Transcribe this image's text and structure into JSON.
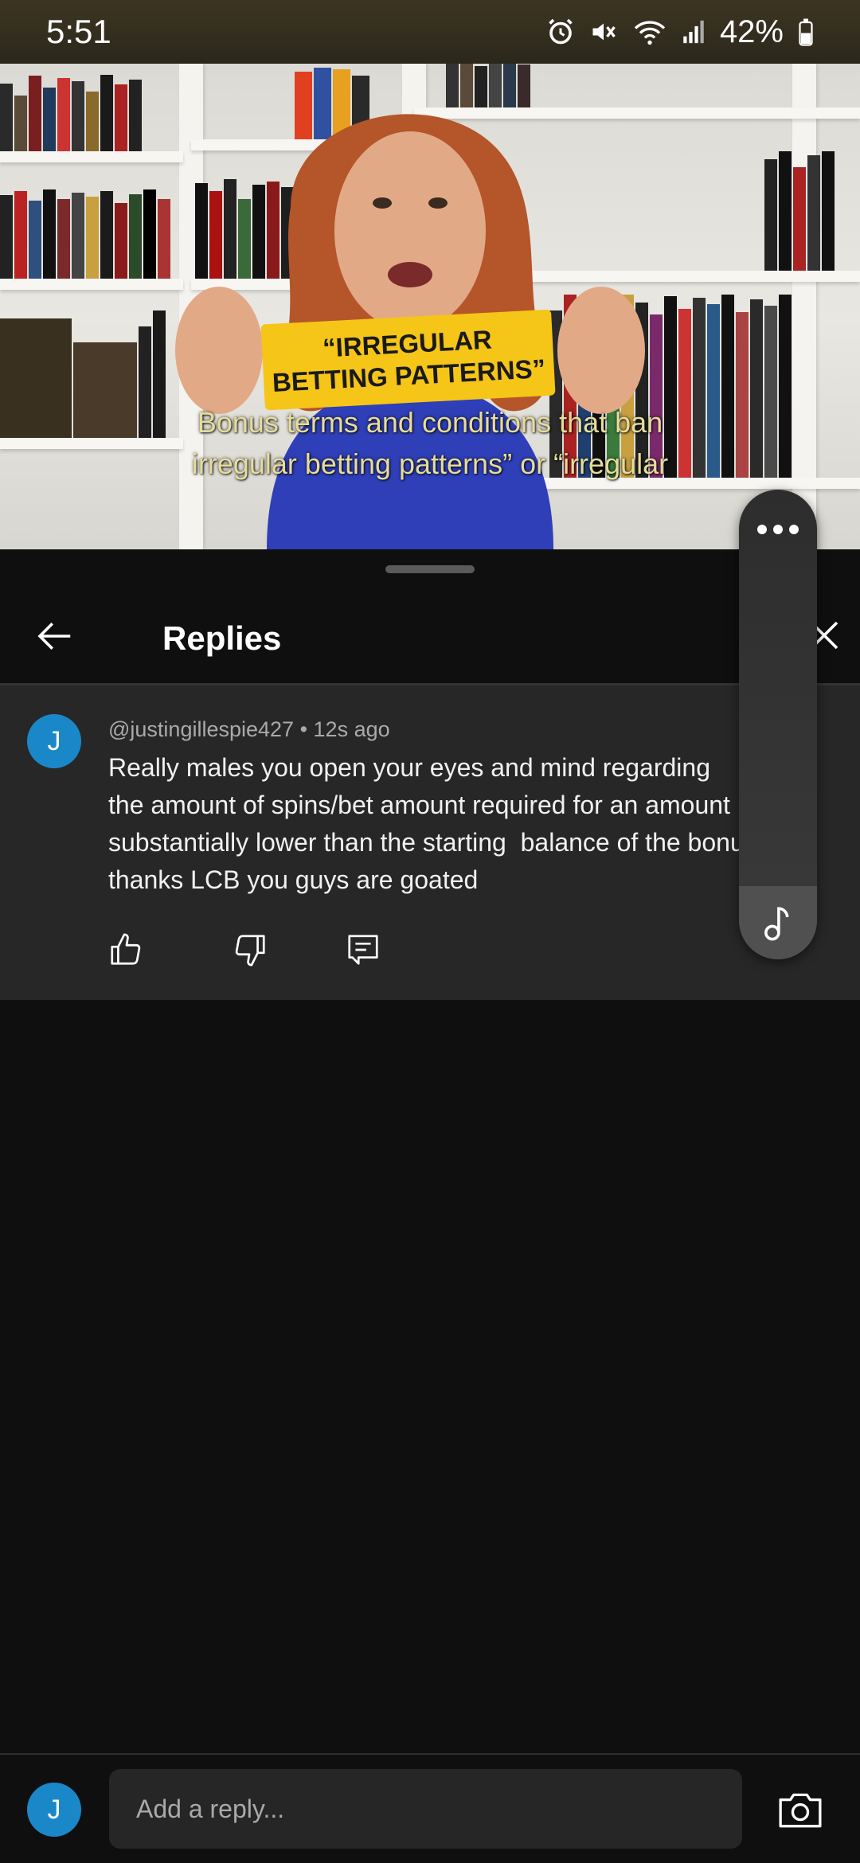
{
  "status_bar": {
    "time": "5:51",
    "battery_percent": "42%"
  },
  "video": {
    "sign_line1": "“IRREGULAR",
    "sign_line2": "BETTING PATTERNS”",
    "caption_line1": "Bonus terms and conditions that ban",
    "caption_line2": "irregular betting patterns” or “irregular"
  },
  "sheet": {
    "title": "Replies"
  },
  "comment": {
    "avatar_initial": "J",
    "author": "@justingillespie427",
    "separator": "•",
    "time_ago": "12s ago",
    "text": "Really males you open your eyes and mind regarding\nthe amount of spins/bet amount required for an amount\nsubstantially lower than the starting  balance of the bonus\nthanks LCB you guys are goated"
  },
  "reply_bar": {
    "avatar_initial": "J",
    "placeholder": "Add a reply..."
  },
  "icons": {
    "back": "arrow-left-icon",
    "close": "close-icon",
    "like": "thumbs-up-icon",
    "dislike": "thumbs-down-icon",
    "reply": "comment-icon",
    "more": "more-horizontal-icon",
    "music": "music-note-icon",
    "camera": "camera-icon"
  },
  "colors": {
    "avatar": "#1a87c9",
    "sign": "#f5c518",
    "caption": "#e6dc9a"
  }
}
